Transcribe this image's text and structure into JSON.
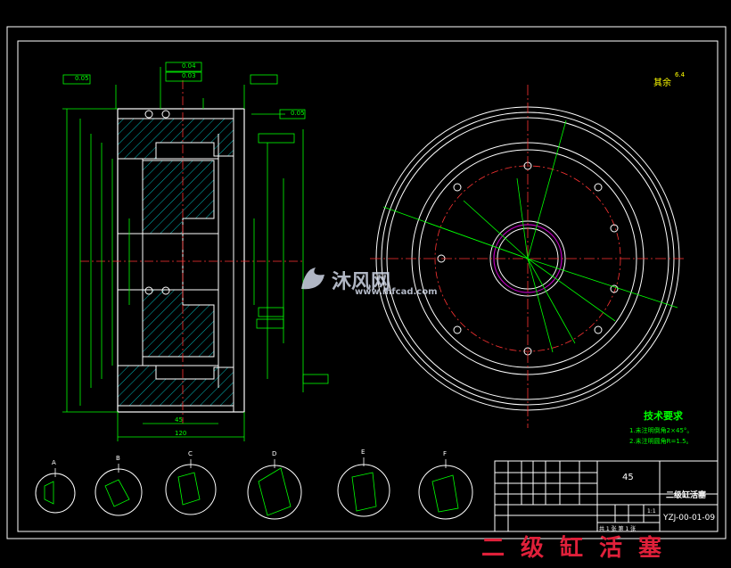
{
  "drawing": {
    "title": "二级缸活塞",
    "watermark_main": "沐风网",
    "watermark_url": "www.mfcad.com",
    "roughness_note_label": "其余",
    "roughness_note_value": "6.4"
  },
  "tech_requirements": {
    "heading": "技术要求",
    "items": [
      "1.未注明倒角2×45°。",
      "2.未注明圆角R=1.5。"
    ]
  },
  "title_block": {
    "material": "45",
    "part_name": "二级缸活塞",
    "drawing_number": "YZJ-00-01-09",
    "scale": "1:1",
    "sheet": "共 1 张  第 1 张"
  },
  "section_views": [
    {
      "id": "A"
    },
    {
      "id": "B"
    },
    {
      "id": "C"
    },
    {
      "id": "D"
    },
    {
      "id": "E"
    },
    {
      "id": "F"
    }
  ],
  "dimensions": {
    "top_tol_1": "0.05",
    "top_tol_2": "0.04",
    "top_left_tol": "0.03",
    "side_ref": "0.05",
    "width_bottom": "120",
    "width_mid": "45"
  }
}
